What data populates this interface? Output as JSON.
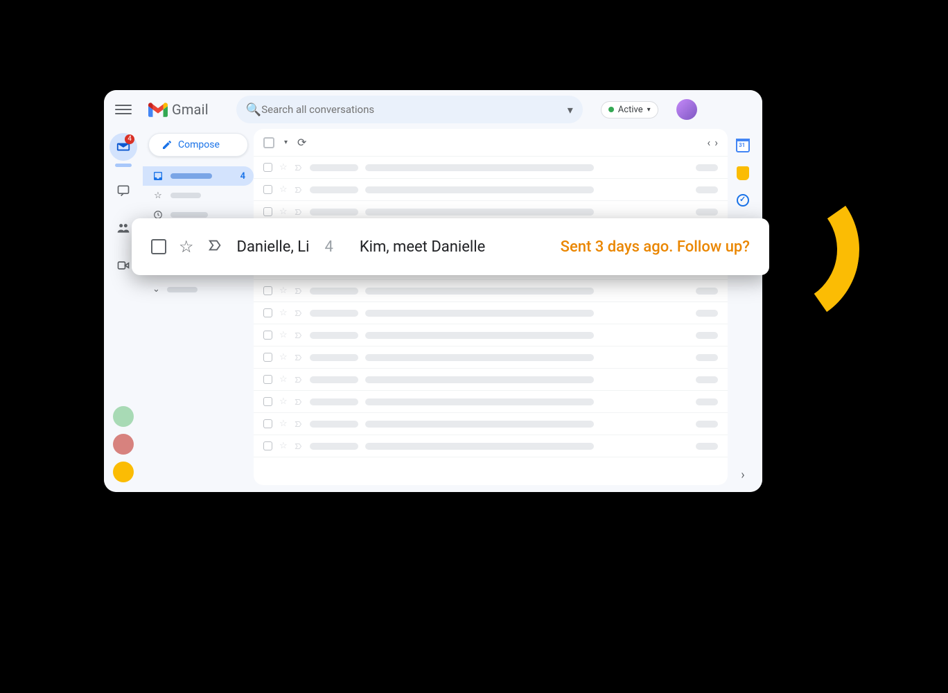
{
  "header": {
    "brand_name": "Gmail",
    "search_placeholder": "Search all conversations",
    "status_label": "Active"
  },
  "rail": {
    "mail_badge": "4"
  },
  "sidebar": {
    "compose_label": "Compose",
    "inbox_count": "4"
  },
  "callout_email": {
    "sender": "Danielle, Li",
    "count": "4",
    "subject": "Kim, meet Danielle",
    "nudge": "Sent 3 days ago. Follow up?"
  },
  "side_apps": {
    "calendar_day": "31"
  }
}
